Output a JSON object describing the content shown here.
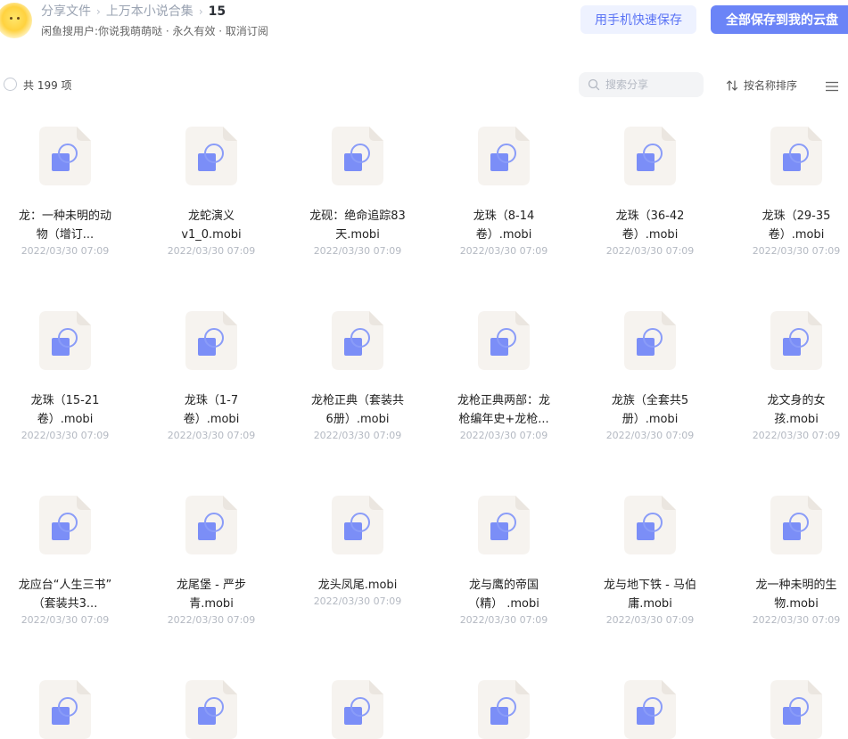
{
  "header": {
    "breadcrumb": [
      "分享文件",
      "上万本小说合集",
      "15"
    ],
    "subtitle": "闲鱼搜用户:你说我萌萌哒 · 永久有效 · 取消订阅",
    "btn_phone": "用手机快速保存",
    "btn_save_all": "全部保存到我的云盘"
  },
  "toolbar": {
    "count": "共 199 项",
    "search_placeholder": "搜索分享",
    "sort_label": "按名称排序"
  },
  "files": [
    {
      "name1": "龙：一种未明的动",
      "name2": "物（增订...",
      "date": "2022/03/30 07:09"
    },
    {
      "name1": "龙蛇演义",
      "name2": "v1_0.mobi",
      "date": "2022/03/30 07:09"
    },
    {
      "name1": "龙砚：绝命追踪83",
      "name2": "天.mobi",
      "date": "2022/03/30 07:09"
    },
    {
      "name1": "龙珠（8-14",
      "name2": "卷）.mobi",
      "date": "2022/03/30 07:09"
    },
    {
      "name1": "龙珠（36-42",
      "name2": "卷）.mobi",
      "date": "2022/03/30 07:09"
    },
    {
      "name1": "龙珠（29-35",
      "name2": "卷）.mobi",
      "date": "2022/03/30 07:09"
    },
    {
      "name1": "龙珠（15-21",
      "name2": "卷）.mobi",
      "date": "2022/03/30 07:09"
    },
    {
      "name1": "龙珠（1-7",
      "name2": "卷）.mobi",
      "date": "2022/03/30 07:09"
    },
    {
      "name1": "龙枪正典（套装共",
      "name2": "6册）.mobi",
      "date": "2022/03/30 07:09"
    },
    {
      "name1": "龙枪正典两部：龙",
      "name2": "枪编年史+龙枪...",
      "date": "2022/03/30 07:09"
    },
    {
      "name1": "龙族（全套共5",
      "name2": "册）.mobi",
      "date": "2022/03/30 07:09"
    },
    {
      "name1": "龙文身的女",
      "name2": "孩.mobi",
      "date": "2022/03/30 07:09"
    },
    {
      "name1": "龙应台“人生三书”",
      "name2": "（套装共3...",
      "date": "2022/03/30 07:09"
    },
    {
      "name1": "龙尾堡 - 严步",
      "name2": "青.mobi",
      "date": "2022/03/30 07:09"
    },
    {
      "name1": "龙头凤尾.mobi",
      "name2": "",
      "date": "2022/03/30 07:09"
    },
    {
      "name1": "龙与鹰的帝国",
      "name2": "（精） .mobi",
      "date": "2022/03/30 07:09"
    },
    {
      "name1": "龙与地下铁 - 马伯",
      "name2": "庸.mobi",
      "date": "2022/03/30 07:09"
    },
    {
      "name1": "龙一种未明的生",
      "name2": "物.mobi",
      "date": "2022/03/30 07:09"
    },
    {
      "name1": "",
      "name2": "",
      "date": ""
    },
    {
      "name1": "",
      "name2": "",
      "date": ""
    },
    {
      "name1": "",
      "name2": "",
      "date": ""
    },
    {
      "name1": "",
      "name2": "",
      "date": ""
    },
    {
      "name1": "",
      "name2": "",
      "date": ""
    },
    {
      "name1": "",
      "name2": "",
      "date": ""
    }
  ],
  "colors": {
    "accent": "#6b84f7",
    "accent_light": "#eef2ff",
    "icon_blue": "#6f86f5"
  }
}
